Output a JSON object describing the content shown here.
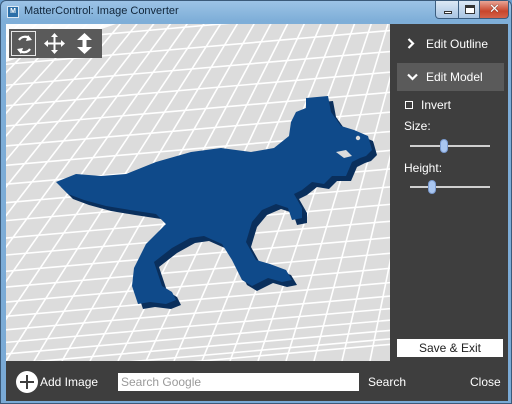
{
  "window": {
    "title": "MatterControl: Image Converter",
    "icon_name": "mattercontrol-app-icon"
  },
  "toolbar": {
    "tools": [
      {
        "name": "rotate-view-icon",
        "active": true
      },
      {
        "name": "move-view-icon",
        "active": false
      },
      {
        "name": "zoom-view-icon",
        "active": false
      }
    ]
  },
  "panel": {
    "edit_outline_label": "Edit Outline",
    "edit_model_label": "Edit Model",
    "invert_label": "Invert",
    "invert_checked": false,
    "size_label": "Size:",
    "size_value": 0.42,
    "height_label": "Height:",
    "height_value": 0.25,
    "save_exit_label": "Save & Exit"
  },
  "bottom": {
    "add_image_label": "Add Image",
    "search_placeholder": "Search Google",
    "search_value": "",
    "search_label": "Search",
    "close_label": "Close"
  },
  "colors": {
    "model": "#0f4a8a",
    "grid_bg": "#dcdcdc",
    "grid_line": "#ffffff",
    "panel_bg": "#3e3e3e",
    "selected_row": "#5a5a5a"
  }
}
